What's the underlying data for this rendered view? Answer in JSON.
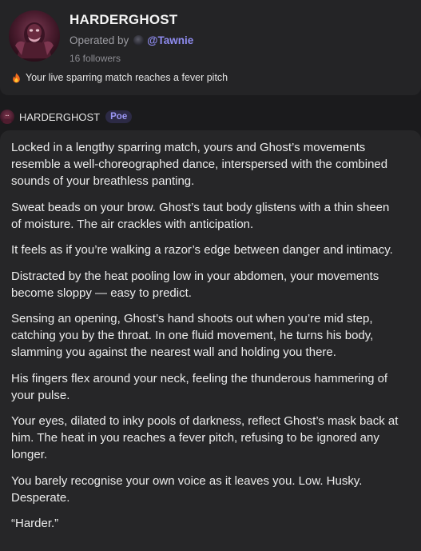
{
  "bot": {
    "name": "HARDERGHOST",
    "operated_by_label": "Operated by",
    "operator_handle": "@Tawnie",
    "followers": "16 followers",
    "description": "Your live sparring match reaches a fever pitch",
    "description_icon": "fire-icon"
  },
  "message": {
    "sender": "HARDERGHOST",
    "badge": "Poe",
    "paragraphs": [
      "Locked in a lengthy sparring match, yours and Ghost’s movements resemble a well-choreographed dance, interspersed with the combined sounds of your breathless panting.",
      "Sweat beads on your brow. Ghost’s taut body glistens with a thin sheen of moisture. The air crackles with anticipation.",
      "It feels as if you’re walking a razor’s edge between danger and intimacy.",
      "Distracted by the heat pooling low in your abdomen, your movements become sloppy — easy to predict.",
      "Sensing an opening, Ghost’s hand shoots out when you’re mid step, catching you by the throat. In one fluid movement, he turns his body, slamming you against the nearest wall and holding you there.",
      "His fingers flex around your neck, feeling the thunderous hammering of your pulse.",
      "Your eyes, dilated to inky pools of darkness, reflect Ghost’s mask back at him. The heat in you reaches a fever pitch, refusing to be ignored any longer.",
      "You barely recognise your own voice as it leaves you. Low. Husky. Desperate.",
      "“Harder.”"
    ]
  },
  "colors": {
    "background": "#1b1b1d",
    "card": "#242426",
    "bubble": "#262628",
    "accent": "#8f8cf0"
  }
}
